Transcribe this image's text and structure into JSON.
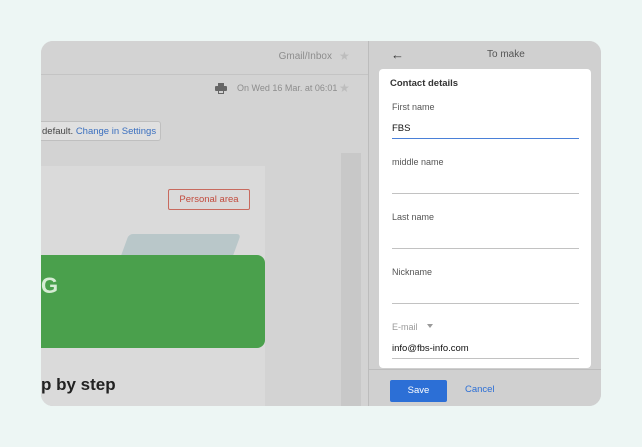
{
  "email_view": {
    "breadcrumb": "Gmail/Inbox",
    "date": "On Wed 16 Mar. at 06:01",
    "notice": {
      "text": "default. ",
      "link": "Change in Settings"
    },
    "personal_area_button": "Personal area",
    "logo_text": "G",
    "heading": "p by step"
  },
  "contact_panel": {
    "title": "To make",
    "section_title": "Contact details",
    "fields": {
      "first_name": {
        "label": "First name",
        "value": "FBS"
      },
      "middle_name": {
        "label": "middle name",
        "value": ""
      },
      "last_name": {
        "label": "Last name",
        "value": ""
      },
      "nickname": {
        "label": "Nickname",
        "value": ""
      },
      "email": {
        "label": "E-mail",
        "value": "info@fbs-info.com"
      }
    },
    "save_label": "Save",
    "cancel_label": "Cancel"
  },
  "colors": {
    "primary": "#2c6fd6",
    "banner_green": "#4aa04c",
    "personal_area_red": "#c24b3d"
  },
  "icons": [
    "star-icon",
    "print-icon",
    "back-arrow-icon",
    "dropdown-caret-icon"
  ]
}
